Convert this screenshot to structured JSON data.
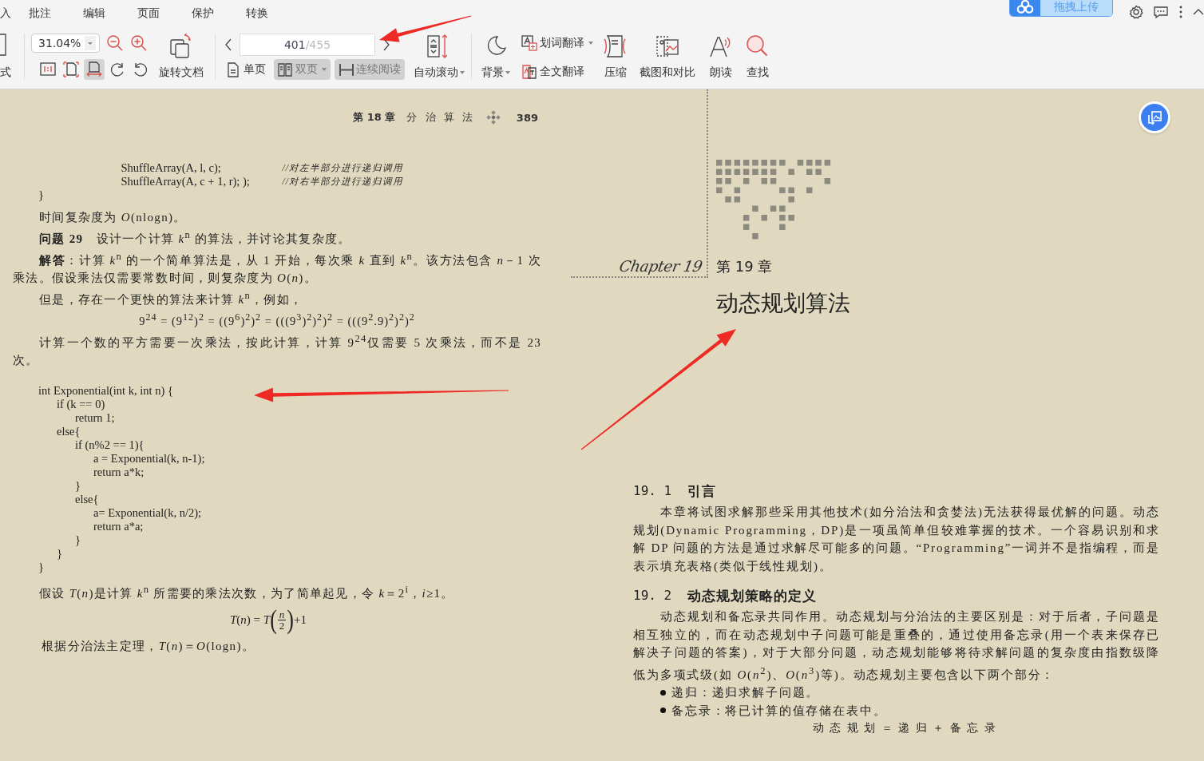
{
  "menu": [
    {
      "label": "入"
    },
    {
      "label": "批注"
    },
    {
      "label": "编辑"
    },
    {
      "label": "页面"
    },
    {
      "label": "保护"
    },
    {
      "label": "转换"
    }
  ],
  "upload": {
    "label": "拖拽上传"
  },
  "toolbar": {
    "mode_label": "式",
    "zoom": "31.04%",
    "fit_modes": [
      {
        "selected": false
      },
      {
        "selected": false
      },
      {
        "selected": true
      }
    ],
    "rotate_label": "旋转文档",
    "page_current": "401",
    "page_total": "/455",
    "view_modes": [
      {
        "label": "单页",
        "selected": false,
        "dropdown": false
      },
      {
        "label": "双页",
        "selected": true,
        "dropdown": true
      },
      {
        "label": "连续阅读",
        "selected": true,
        "dropdown": false
      }
    ],
    "tools": [
      {
        "kind": "auto-scroll",
        "label": "自动滚动",
        "dropdown": true
      },
      {
        "kind": "background",
        "label": "背景",
        "dropdown": true
      },
      {
        "kind": "translate",
        "items": [
          {
            "label": "划词翻译",
            "dropdown": true
          },
          {
            "label": "全文翻译",
            "dropdown": false
          }
        ]
      },
      {
        "kind": "compress",
        "label": "压缩",
        "dropdown": false
      },
      {
        "kind": "screenshot",
        "label": "截图和对比",
        "dropdown": false
      },
      {
        "kind": "read-aloud",
        "label": "朗读",
        "dropdown": false
      },
      {
        "kind": "find",
        "label": "查找",
        "dropdown": false
      }
    ]
  },
  "left_page": {
    "chapter": "第 18 章",
    "chapter_title": "分 治 算 法",
    "page_number": "389",
    "blocks": [
      {
        "kind": "code",
        "lines": [
          {
            "code": "                  ShuffleArray(A, l, c);",
            "comment": "//对左半部分进行递归调用"
          },
          {
            "code": "                  ShuffleArray(A, c + 1, r); );",
            "comment": "//对右半部分进行递归调用"
          },
          {
            "code": "}"
          }
        ]
      },
      {
        "kind": "text",
        "text": "时间复杂度为 *O*(nlogn)。"
      },
      {
        "kind": "text",
        "text": "**问题 29**　设计一个计算 *k*$^{n}$ 的算法，并讨论其复杂度。"
      },
      {
        "kind": "text",
        "text": "**解答**：计算 *k*$^{n}$ 的一个简单算法是，从 1 开始，每次乘 *k* 直到 *k*$^{n}$。该方法包含 *n*－1 次乘法。假设乘法仅需要常数时间，则复杂度为 *O*(*n*)。"
      },
      {
        "kind": "text",
        "text": "但是，存在一个更快的算法来计算 *k*$^{n}$，例如，"
      },
      {
        "kind": "formula",
        "text": "9$^{24}$ = (9$^{12}$)$^{2}$ = ((9$^{6}$)$^{2}$)$^{2}$ = (((9$^{3}$)$^{2}$)$^{2}$)$^{2}$ = (((9$^{2}$.9)$^{2}$)$^{2}$)$^{2}$"
      },
      {
        "kind": "text",
        "text": "计算一个数的平方需要一次乘法，按此计算，计算 9$^{24}$仅需要 5 次乘法，而不是 23 次。"
      },
      {
        "kind": "code",
        "lines": [
          {
            "code": "int Exponential(int k, int n) {"
          },
          {
            "code": "    if (k == 0)"
          },
          {
            "code": "        return 1;"
          },
          {
            "code": "    else{"
          },
          {
            "code": "        if (n%2 == 1){"
          },
          {
            "code": "            a = Exponential(k, n-1);"
          },
          {
            "code": "            return a*k;"
          },
          {
            "code": "        }"
          },
          {
            "code": "        else{"
          },
          {
            "code": "            a= Exponential(k, n/2);"
          },
          {
            "code": "            return a*a;"
          },
          {
            "code": "        }"
          },
          {
            "code": "    }"
          },
          {
            "code": "}"
          }
        ]
      },
      {
        "kind": "text",
        "text": "假设 *T*(*n*)是计算 *k*$^{n}$ 所需要的乘法次数，为了简单起见，令 *k*＝2$^{i}$，*i*≥1。"
      },
      {
        "kind": "fraction",
        "left": "*T*(*n*) = *T*",
        "open": "(",
        "numerator": "*n*",
        "denominator": "2",
        "close": ")",
        "right": "+1"
      },
      {
        "kind": "text",
        "text": "根据分治法主定理，*T*(*n*)＝*O*(logn)。"
      }
    ]
  },
  "right_page": {
    "chapter_en": "Chapter 19",
    "chapter": "第 19 章",
    "title": "动态规划算法",
    "blocks": [
      {
        "kind": "heading",
        "number": "19. 1",
        "text": "引言"
      },
      {
        "kind": "para",
        "text": "本章将试图求解那些采用其他技术(如分治法和贪婪法)无法获得最优解的问题。动态规划(Dynamic Programming，DP)是一项虽简单但较难掌握的技术。一个容易识别和求解 DP 问题的方法是通过求解尽可能多的问题。“Programming”一词并不是指编程，而是表示填充表格(类似于线性规划)。"
      },
      {
        "kind": "heading",
        "number": "19. 2",
        "text": "动态规划策略的定义"
      },
      {
        "kind": "para",
        "text": "动态规划和备忘录共同作用。动态规划与分治法的主要区别是：对于后者，子问题是相互独立的，而在动态规划中子问题可能是重叠的，通过使用备忘录(用一个表来保存已解决子问题的答案)，对于大部分问题，动态规划能够将待求解问题的复杂度由指数级降低为多项式级(如 *O*(*n*$^{2}$)、*O*(*n*$^{3}$)等)。动态规划主要包含以下两个部分："
      },
      {
        "kind": "bullet",
        "text": "递归：递归求解子问题。"
      },
      {
        "kind": "bullet",
        "text": "备忘录：将已计算的值存储在表中。"
      },
      {
        "kind": "formula",
        "text": "动 态 规 划 ＝ 递 归 ＋ 备 忘 录"
      }
    ]
  },
  "annotations": [
    {
      "kind": "arrow"
    },
    {
      "kind": "arrow"
    },
    {
      "kind": "arrow"
    }
  ]
}
